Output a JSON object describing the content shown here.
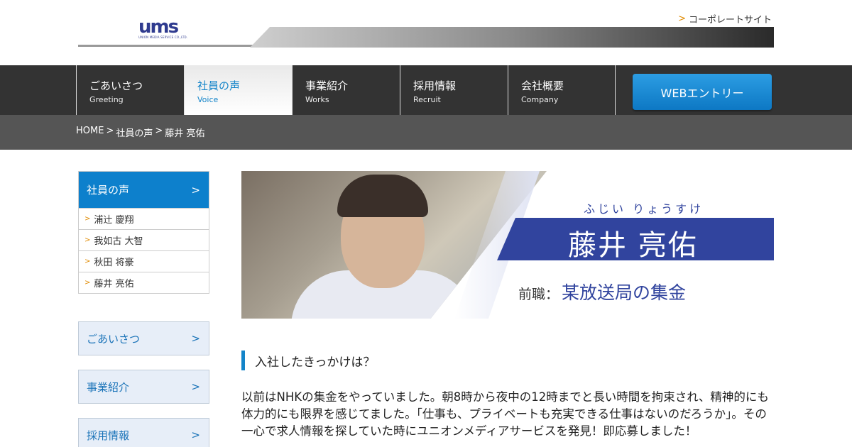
{
  "header": {
    "logo_text": "ums",
    "logo_sub": "UNION MEDIA SERVICE CO.,LTD.",
    "corporate_link": "コーポレートサイト",
    "corporate_arrow": ">"
  },
  "nav": {
    "items": [
      {
        "ja": "ごあいさつ",
        "en": "Greeting"
      },
      {
        "ja": "社員の声",
        "en": "Voice"
      },
      {
        "ja": "事業紹介",
        "en": "Works"
      },
      {
        "ja": "採用情報",
        "en": "Recruit"
      },
      {
        "ja": "会社概要",
        "en": "Company"
      }
    ],
    "entry_button": "WEBエントリー"
  },
  "breadcrumb": {
    "home": "HOME",
    "sep1": ">",
    "section": "社員の声",
    "sep2": ">",
    "current": "藤井 亮佑"
  },
  "sidebar": {
    "heading": "社員の声",
    "heading_arrow": ">",
    "item_arrow": ">",
    "items": [
      "浦辻 慶翔",
      "我如古 大智",
      "秋田 将豪",
      "藤井 亮佑"
    ],
    "links": [
      {
        "label": "ごあいさつ",
        "arrow": ">"
      },
      {
        "label": "事業紹介",
        "arrow": ">"
      },
      {
        "label": "採用情報",
        "arrow": ">"
      }
    ]
  },
  "hero": {
    "kana": "ふじい りょうすけ",
    "name": "藤井 亮佑",
    "prev_job_label": "前職：",
    "prev_job": "某放送局の集金"
  },
  "article": {
    "question": "入社したきっかけは？",
    "answer": "以前はNHKの集金をやっていました。朝8時から夜中の12時までと長い時間を拘束され、精神的にも体力的にも限界を感じてました。「仕事も、プライベートも充実できる仕事はないのだろうか」。その一心で求人情報を探していた時にユニオンメディアサービスを発見！即応募しました！"
  },
  "colors": {
    "accent_blue": "#0d80cc",
    "nav_bg": "#333333",
    "name_band": "#31449e",
    "arrow_orange": "#e08a00"
  }
}
